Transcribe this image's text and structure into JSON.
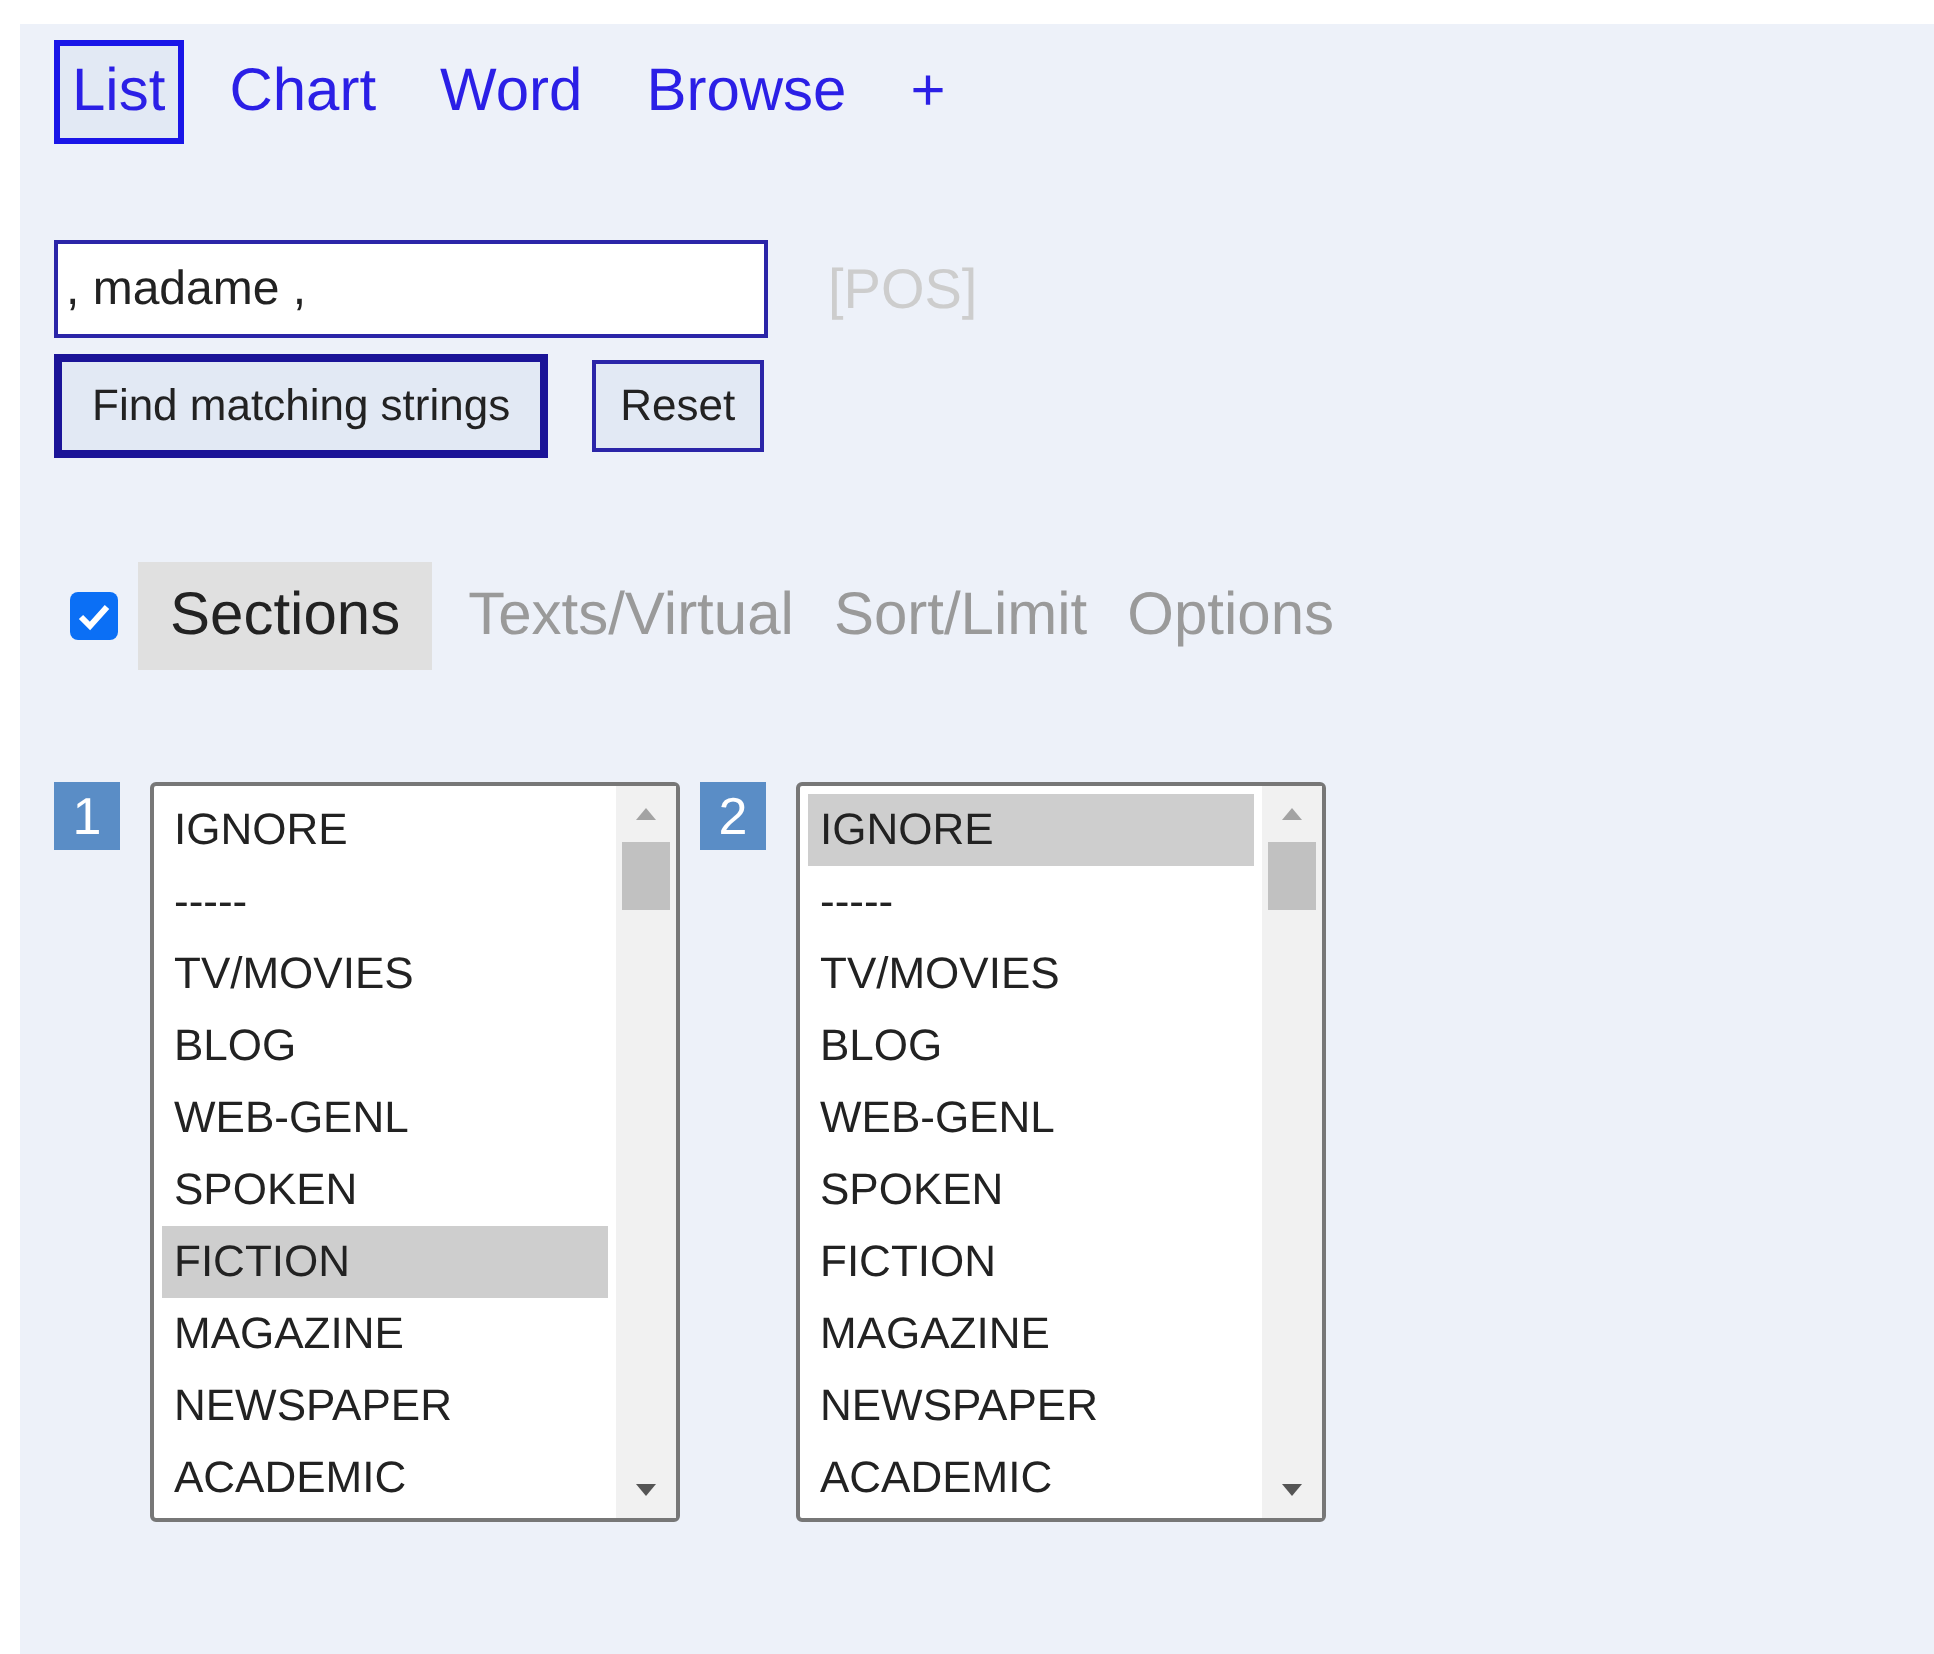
{
  "tabs": [
    {
      "label": "List",
      "selected": true
    },
    {
      "label": "Chart",
      "selected": false
    },
    {
      "label": "Word",
      "selected": false
    },
    {
      "label": "Browse",
      "selected": false
    },
    {
      "label": "+",
      "selected": false
    }
  ],
  "search": {
    "value": ", madame ,",
    "pos_label": "[POS]"
  },
  "buttons": [
    {
      "label": "Find matching strings",
      "kind": "primary"
    },
    {
      "label": "Reset",
      "kind": "secondary"
    }
  ],
  "options": {
    "checked": true,
    "tabs": [
      {
        "label": "Sections",
        "selected": true
      },
      {
        "label": "Texts/Virtual",
        "selected": false
      },
      {
        "label": "Sort/Limit",
        "selected": false
      },
      {
        "label": "Options",
        "selected": false
      }
    ]
  },
  "section_lists": [
    {
      "number": "1",
      "items": [
        {
          "label": "IGNORE",
          "selected": false
        },
        {
          "label": "-----",
          "selected": false
        },
        {
          "label": "TV/MOVIES",
          "selected": false
        },
        {
          "label": "BLOG",
          "selected": false
        },
        {
          "label": "WEB-GENL",
          "selected": false
        },
        {
          "label": "SPOKEN",
          "selected": false
        },
        {
          "label": "FICTION",
          "selected": true
        },
        {
          "label": "MAGAZINE",
          "selected": false
        },
        {
          "label": "NEWSPAPER",
          "selected": false
        },
        {
          "label": "ACADEMIC",
          "selected": false
        }
      ]
    },
    {
      "number": "2",
      "items": [
        {
          "label": "IGNORE",
          "selected": true
        },
        {
          "label": "-----",
          "selected": false
        },
        {
          "label": "TV/MOVIES",
          "selected": false
        },
        {
          "label": "BLOG",
          "selected": false
        },
        {
          "label": "WEB-GENL",
          "selected": false
        },
        {
          "label": "SPOKEN",
          "selected": false
        },
        {
          "label": "FICTION",
          "selected": false
        },
        {
          "label": "MAGAZINE",
          "selected": false
        },
        {
          "label": "NEWSPAPER",
          "selected": false
        },
        {
          "label": "ACADEMIC",
          "selected": false
        }
      ]
    }
  ]
}
